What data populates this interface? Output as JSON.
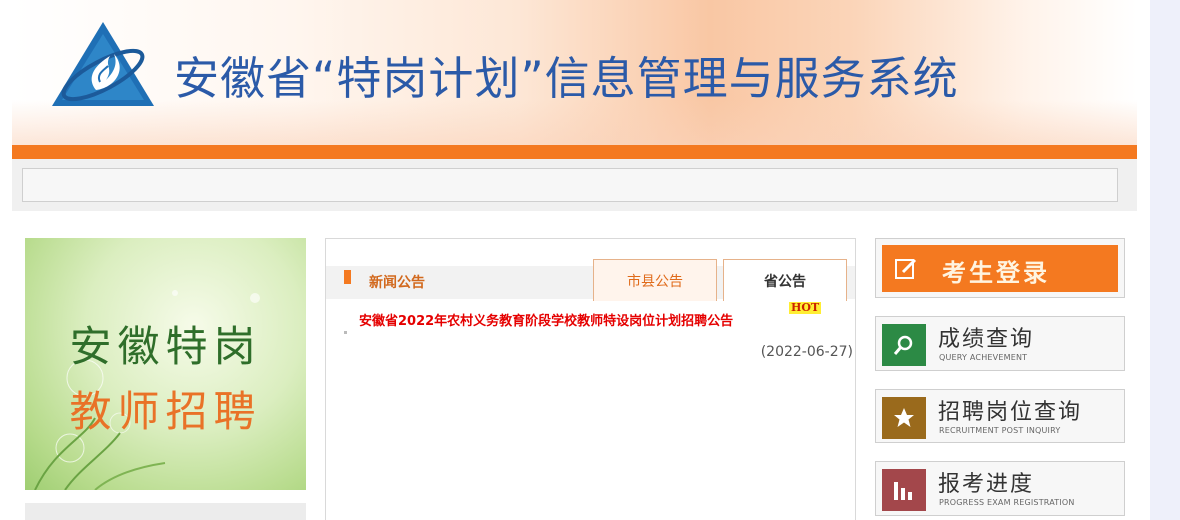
{
  "header": {
    "title": "安徽省“特岗计划”信息管理与服务系统"
  },
  "promo": {
    "line1": "安徽特岗",
    "line2": "教师招聘"
  },
  "news": {
    "heading": "新闻公告",
    "tabs": [
      {
        "label": "市县公告"
      },
      {
        "label": "省公告"
      }
    ],
    "article": {
      "title": "安徽省2022年农村义务教育阶段学校教师特设岗位计划招聘公告",
      "badge": "HOT",
      "date": "(2022-06-27)"
    }
  },
  "quick_links": {
    "login": {
      "label": "考生登录",
      "icon": "edit-icon"
    },
    "score": {
      "label": "成绩查询",
      "sub": "QUERY ACHEVEMENT",
      "icon": "search-icon"
    },
    "posts": {
      "label": "招聘岗位查询",
      "sub": "RECRUITMENT POST INQUIRY",
      "icon": "star-icon"
    },
    "progress": {
      "label": "报考进度",
      "sub": "PROGRESS EXAM REGISTRATION",
      "icon": "bar-chart-icon"
    }
  },
  "colors": {
    "accent_orange": "#f47920",
    "title_blue": "#2b5aa8",
    "score_green": "#2c8a45",
    "posts_brown": "#9a6a1c",
    "progress_red": "#a3474b"
  }
}
